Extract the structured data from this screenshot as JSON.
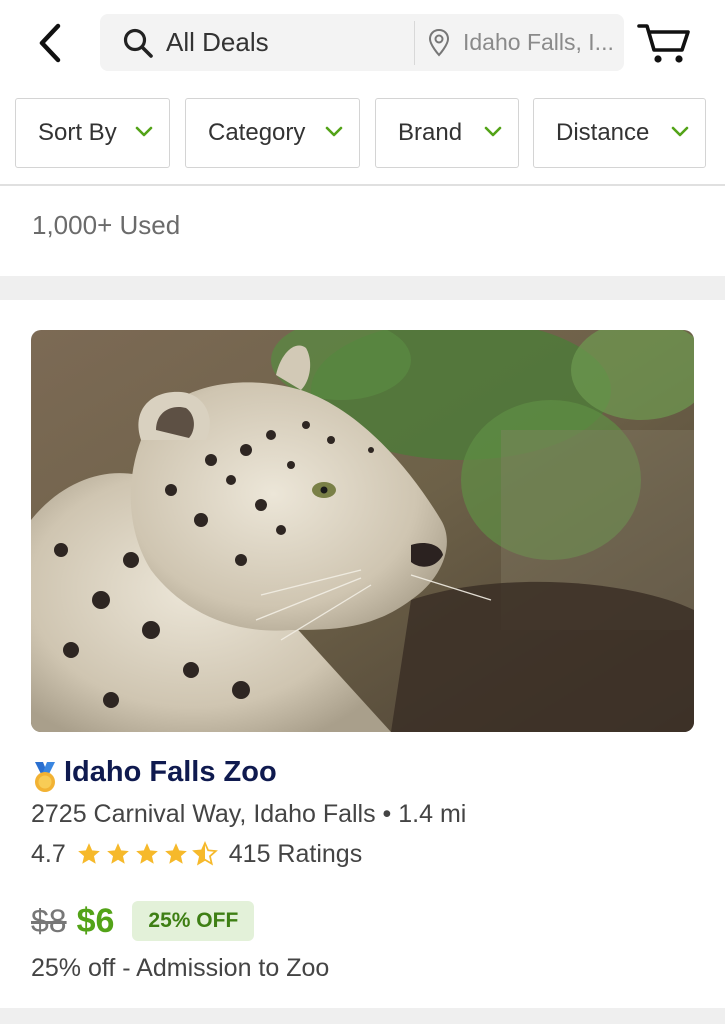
{
  "header": {
    "search_text": "All Deals",
    "location_text": "Idaho Falls, I...",
    "icons": {
      "back": "back-arrow-icon",
      "search": "search-icon",
      "location": "location-pin-icon",
      "cart": "cart-icon"
    }
  },
  "filters": [
    {
      "label": "Sort By"
    },
    {
      "label": "Category"
    },
    {
      "label": "Brand"
    },
    {
      "label": "Distance"
    }
  ],
  "results": {
    "count_text": "1,000+ Used"
  },
  "deal": {
    "title": "Idaho Falls Zoo",
    "address": "2725 Carnival Way, Idaho Falls • 1.4 mi",
    "rating_value": "4.7",
    "rating_stars": 4.5,
    "rating_count": "415 Ratings",
    "old_price": "$8",
    "new_price": "$6",
    "discount_badge": "25% OFF",
    "description": "25% off - Admission to Zoo",
    "image": "snow-leopard-photo"
  },
  "colors": {
    "accent_green": "#53a318",
    "badge_bg": "#e3f1d9",
    "title_navy": "#0f1a4f",
    "star_yellow": "#f6b92b"
  }
}
